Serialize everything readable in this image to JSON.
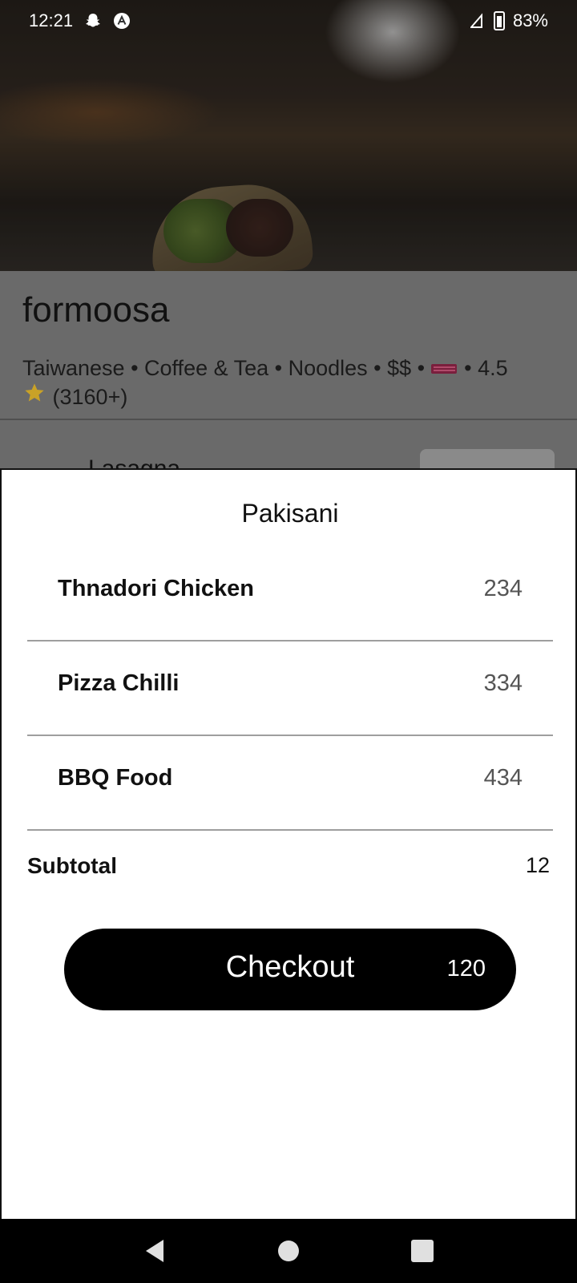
{
  "status_bar": {
    "time": "12:21",
    "battery": "83%",
    "icons": [
      "snapchat-icon",
      "app-a-icon",
      "signal-icon",
      "battery-icon"
    ]
  },
  "restaurant": {
    "name": "formoosa",
    "meta_text": "Taiwanese • Coffee & Tea • Noodles  • $$ • ",
    "rating_text": " • 4.5",
    "reviews": "(3160+)",
    "behind_item_title": "Lasagna"
  },
  "sheet": {
    "title": "Pakisani",
    "items": [
      {
        "name": "Thnadori Chicken",
        "price": "234"
      },
      {
        "name": "Pizza Chilli",
        "price": "334"
      },
      {
        "name": "BBQ Food",
        "price": "434"
      }
    ],
    "subtotal_label": "Subtotal",
    "subtotal_value": "12",
    "checkout_label": "Checkout",
    "checkout_total": "120"
  },
  "colors": {
    "sheet_bg": "#ffffff",
    "checkout_bg": "#000000",
    "divider": "#9e9e9e",
    "star": "#f5c518"
  }
}
